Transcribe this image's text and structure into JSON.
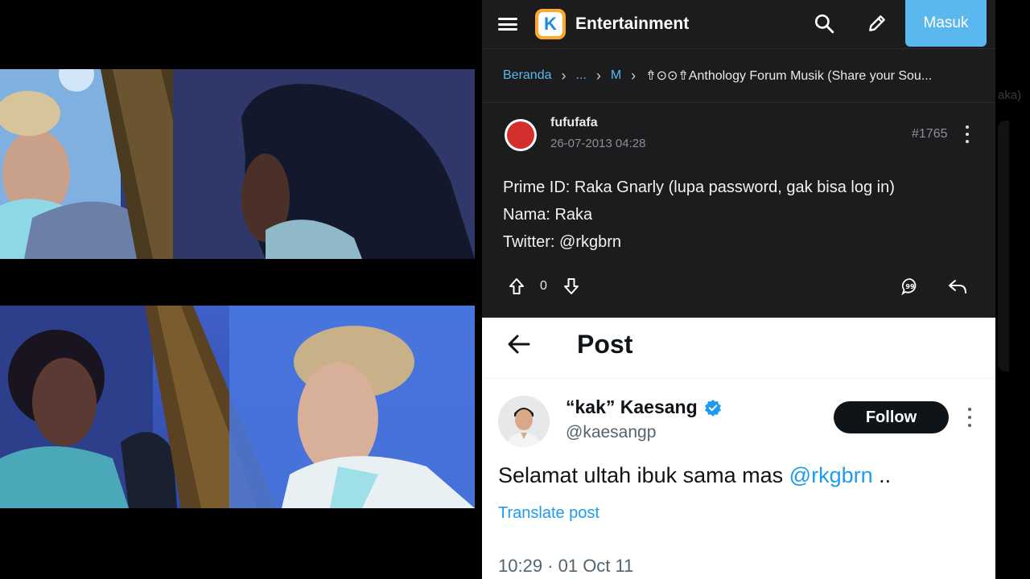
{
  "kaskus": {
    "title": "Entertainment",
    "login_label": "Masuk",
    "breadcrumb": {
      "home": "Beranda",
      "ellipsis": "...",
      "short": "M",
      "current": "⇮⊙⊙⇮Anthology Forum Musik (Share your Sou..."
    },
    "post": {
      "username": "fufufafa",
      "date": "26-07-2013 04:28",
      "number": "#1765",
      "lines": [
        "Prime ID: Raka Gnarly (lupa password, gak bisa log in)",
        "Nama: Raka",
        "Twitter: @rkgbrn"
      ],
      "vote_count": "0"
    }
  },
  "x": {
    "header_title": "Post",
    "display_name": "“kak” Kaesang",
    "handle": "@kaesangp",
    "follow_label": "Follow",
    "tweet_text": "Selamat ultah ibuk sama mas ",
    "tweet_mention": "@rkgbrn",
    "tweet_suffix": " ..",
    "translate_label": "Translate post",
    "timestamp": "10:29 · 01 Oct 11"
  },
  "side": {
    "partial_text": "aka)"
  },
  "colors": {
    "kaskus_bg": "#1c1c1e",
    "kaskus_accent": "#5ab8ee",
    "x_link": "#1d9bf0",
    "x_follow_bg": "#0f1419"
  }
}
